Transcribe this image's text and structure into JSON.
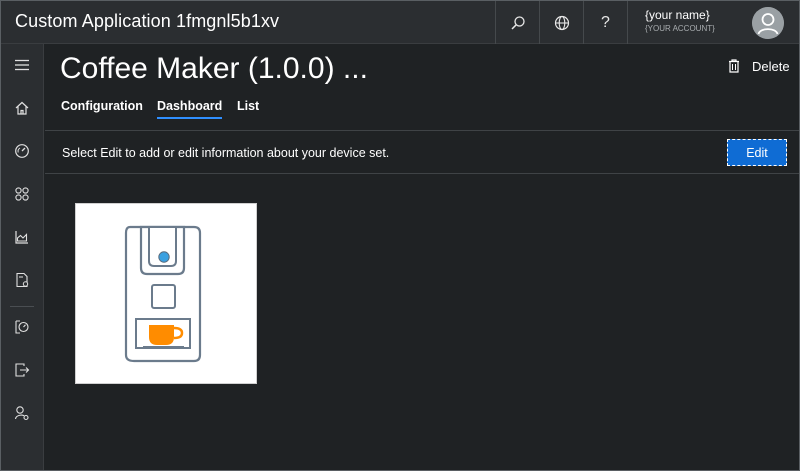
{
  "app": {
    "title": "Custom Application 1fmgnl5b1xv"
  },
  "header": {
    "search_icon": "search-icon",
    "globe_icon": "globe-icon",
    "help_label": "?",
    "account": {
      "name": "{your name}",
      "subtitle": "{YOUR ACCOUNT}"
    }
  },
  "sidebar": {
    "items": [
      {
        "name": "menu",
        "icon": "hamburger-icon"
      },
      {
        "name": "home",
        "icon": "home-icon"
      },
      {
        "name": "dashboard",
        "icon": "gauge-icon"
      },
      {
        "name": "device-sets",
        "icon": "grid-icon"
      },
      {
        "name": "analytics",
        "icon": "chart-icon"
      },
      {
        "name": "device-templates",
        "icon": "template-icon"
      },
      {
        "name": "jobs",
        "icon": "jobs-icon"
      },
      {
        "name": "data-export",
        "icon": "export-icon"
      },
      {
        "name": "administration",
        "icon": "admin-icon"
      }
    ]
  },
  "page": {
    "title": "Coffee Maker (1.0.0) ...",
    "delete_label": "Delete",
    "tabs": [
      {
        "label": "Configuration",
        "active": false
      },
      {
        "label": "Dashboard",
        "active": true
      },
      {
        "label": "List",
        "active": false
      }
    ],
    "info_text": "Select Edit to add or edit information about your device set.",
    "edit_label": "Edit"
  },
  "colors": {
    "background": "#1f2224",
    "chrome": "#2b2e31",
    "accent": "#0f6cd4",
    "tab_underline": "#2f8fff",
    "cup": "#ff8c00",
    "indicator": "#3aa0e0",
    "outline": "#6b7b8c"
  }
}
